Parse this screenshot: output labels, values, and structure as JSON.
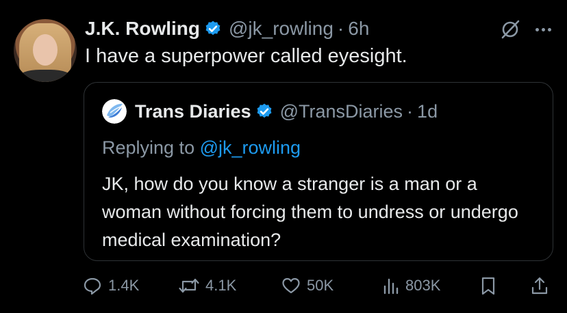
{
  "author": {
    "name": "J.K. Rowling",
    "handle": "@jk_rowling",
    "separator": "·",
    "time": "6h"
  },
  "tweet": {
    "text": "I have a superpower called eyesight."
  },
  "quoted": {
    "name": "Trans Diaries",
    "handle": "@TransDiaries",
    "separator": "·",
    "time": "1d",
    "replying_prefix": "Replying to ",
    "replying_mention": "@jk_rowling",
    "text": "JK, how do you know a stranger is a man or a woman without forcing them to undress or undergo medical examination?"
  },
  "actions": {
    "replies": "1.4K",
    "reposts": "4.1K",
    "likes": "50K",
    "views": "803K"
  },
  "colors": {
    "background": "#000000",
    "text": "#e7e9ea",
    "secondary": "#8b98a5",
    "accent": "#1d9bf0"
  },
  "icons": [
    "verified-badge-icon",
    "grok-icon",
    "more-icon",
    "reply-icon",
    "repost-icon",
    "like-icon",
    "views-icon",
    "bookmark-icon",
    "share-icon"
  ]
}
